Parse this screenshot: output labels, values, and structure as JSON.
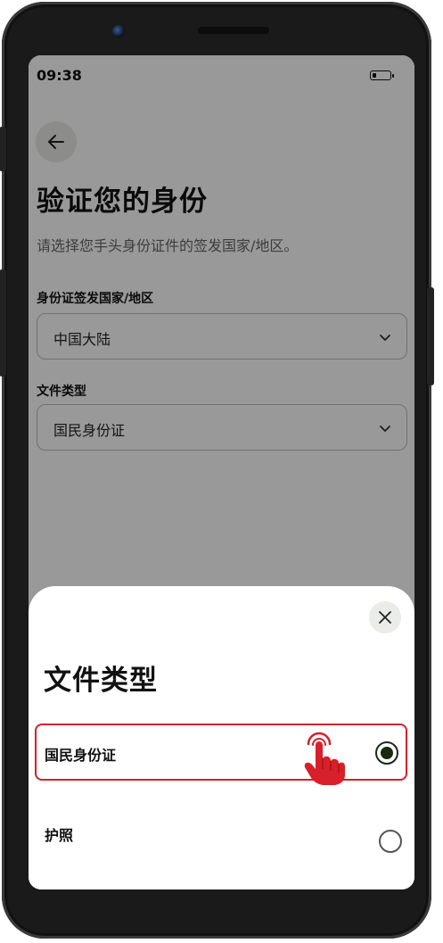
{
  "status_bar": {
    "time": "09:38"
  },
  "page": {
    "title": "验证您的身份",
    "subtitle": "请选择您手头身份证件的签发国家/地区。",
    "country_field": {
      "label": "身份证签发国家/地区",
      "value": "中国大陆"
    },
    "document_field": {
      "label": "文件类型",
      "value": "国民身份证"
    }
  },
  "sheet": {
    "title": "文件类型",
    "options": [
      {
        "label": "国民身份证",
        "selected": true
      },
      {
        "label": "护照",
        "selected": false
      }
    ]
  },
  "colors": {
    "highlight": "#d6202a",
    "tap_hand": "#d6202a",
    "icon_bg": "#e9ece7"
  },
  "icons": [
    "back-arrow-icon",
    "chevron-down-icon",
    "close-icon",
    "tap-hand-icon",
    "battery-icon",
    "camera"
  ]
}
